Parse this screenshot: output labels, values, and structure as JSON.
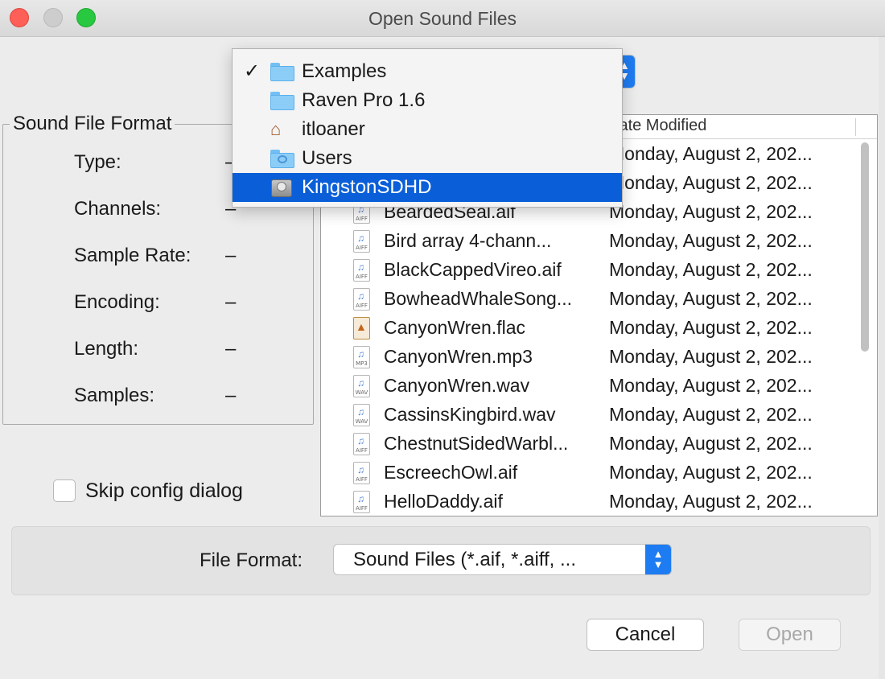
{
  "window": {
    "title": "Open Sound Files"
  },
  "location_menu": {
    "items": [
      {
        "label": "Examples",
        "icon": "folder-icon",
        "checked": true,
        "highlighted": false
      },
      {
        "label": "Raven Pro 1.6",
        "icon": "folder-icon",
        "checked": false,
        "highlighted": false
      },
      {
        "label": "itloaner",
        "icon": "home-icon",
        "checked": false,
        "highlighted": false
      },
      {
        "label": "Users",
        "icon": "users-folder-icon",
        "checked": false,
        "highlighted": false
      },
      {
        "label": "KingstonSDHD",
        "icon": "drive-icon",
        "checked": false,
        "highlighted": true
      }
    ],
    "check_mark": "✓"
  },
  "sound_file_format": {
    "title": "Sound File Format",
    "properties": [
      {
        "label": "Type:",
        "value": "–"
      },
      {
        "label": "Channels:",
        "value": "–"
      },
      {
        "label": "Sample Rate:",
        "value": "–"
      },
      {
        "label": "Encoding:",
        "value": "–"
      },
      {
        "label": "Length:",
        "value": "–"
      },
      {
        "label": "Samples:",
        "value": "–"
      }
    ]
  },
  "skip_config": {
    "label": "Skip config dialog",
    "checked": false
  },
  "file_list": {
    "date_header": "Date Modified",
    "rows": [
      {
        "name": "",
        "date": "Monday, August 2, 202...",
        "ext": ""
      },
      {
        "name": "",
        "date": "Monday, August 2, 202...",
        "ext": ""
      },
      {
        "name": "BeardedSeal.aif",
        "date": "Monday, August 2, 202...",
        "ext": "AIFF"
      },
      {
        "name": "Bird array 4-chann...",
        "date": "Monday, August 2, 202...",
        "ext": "AIFF"
      },
      {
        "name": "BlackCappedVireo.aif",
        "date": "Monday, August 2, 202...",
        "ext": "AIFF"
      },
      {
        "name": "BowheadWhaleSong...",
        "date": "Monday, August 2, 202...",
        "ext": "AIFF"
      },
      {
        "name": "CanyonWren.flac",
        "date": "Monday, August 2, 202...",
        "ext": "FLAC"
      },
      {
        "name": "CanyonWren.mp3",
        "date": "Monday, August 2, 202...",
        "ext": "MP3"
      },
      {
        "name": "CanyonWren.wav",
        "date": "Monday, August 2, 202...",
        "ext": "WAV"
      },
      {
        "name": "CassinsKingbird.wav",
        "date": "Monday, August 2, 202...",
        "ext": "WAV"
      },
      {
        "name": "ChestnutSidedWarbl...",
        "date": "Monday, August 2, 202...",
        "ext": "AIFF"
      },
      {
        "name": "EscreechOwl.aif",
        "date": "Monday, August 2, 202...",
        "ext": "AIFF"
      },
      {
        "name": "HelloDaddy.aif",
        "date": "Monday, August 2, 202...",
        "ext": "AIFF"
      }
    ]
  },
  "file_format": {
    "label": "File Format:",
    "value": "Sound Files (*.aif, *.aiff, ..."
  },
  "buttons": {
    "cancel": "Cancel",
    "open": "Open",
    "open_enabled": false
  },
  "colors": {
    "accent": "#0a5fd8",
    "stepper": "#1e7cf2",
    "close": "#fe5f57",
    "maximize": "#28c840"
  }
}
